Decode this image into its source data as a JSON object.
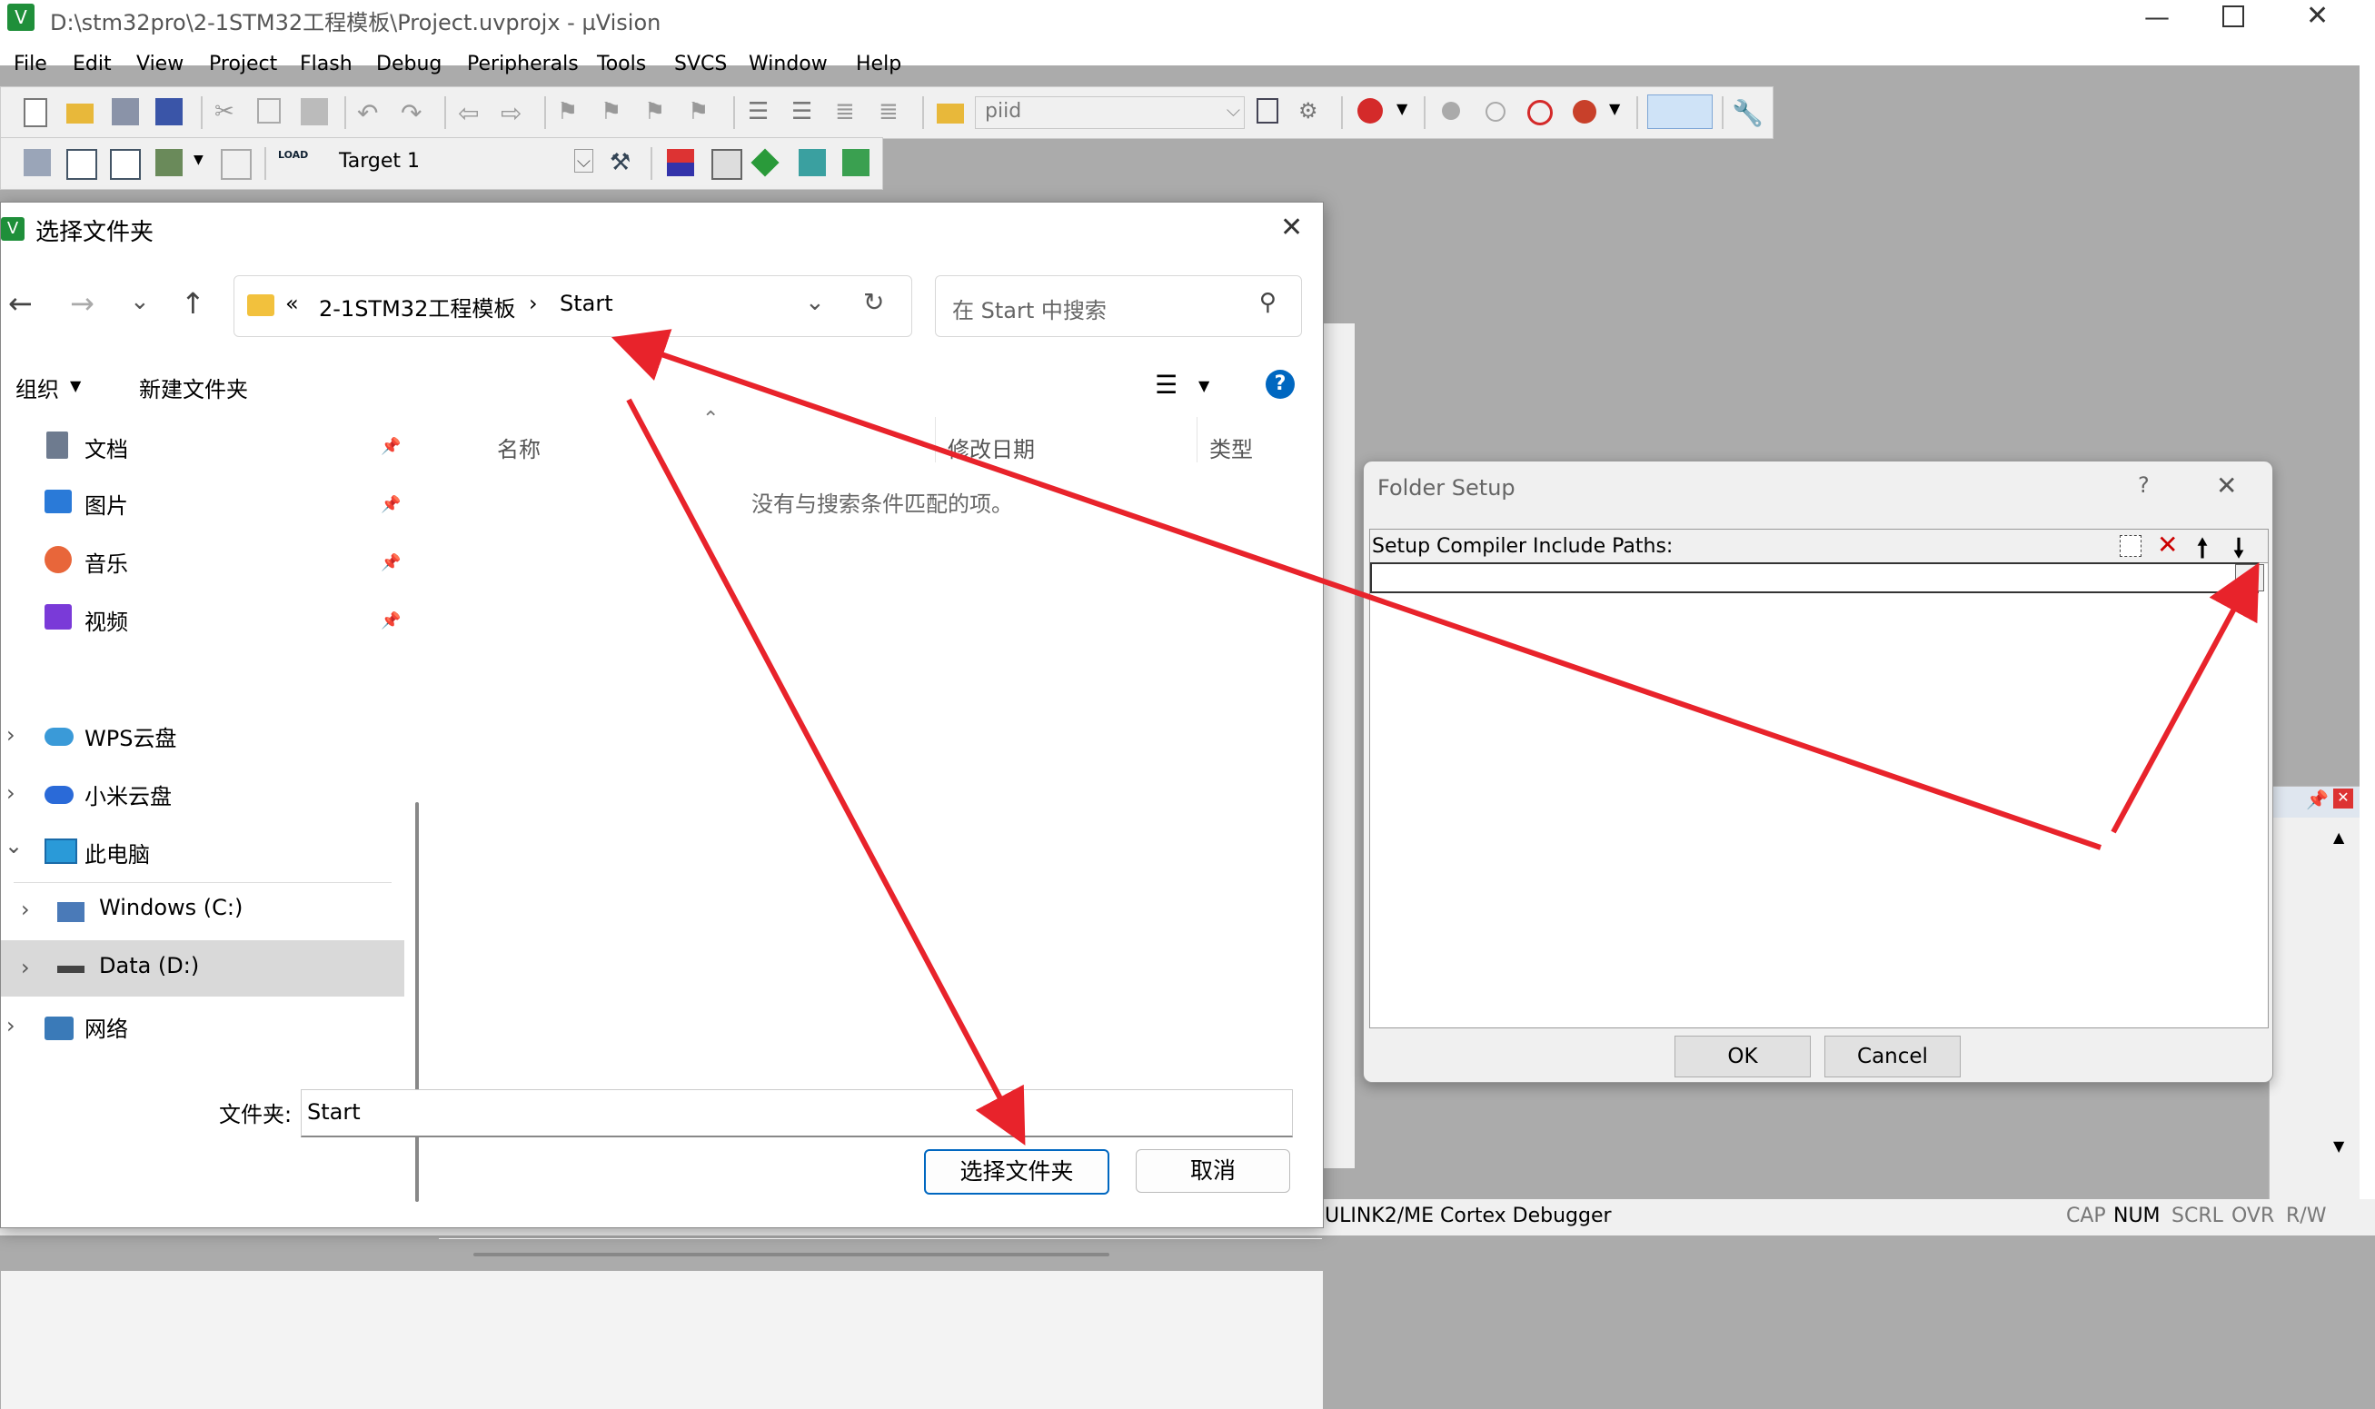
{
  "main": {
    "title": "D:\\stm32pro\\2-1STM32工程模板\\Project.uvprojx - µVision",
    "menu": [
      "File",
      "Edit",
      "View",
      "Project",
      "Flash",
      "Debug",
      "Peripherals",
      "Tools",
      "SVCS",
      "Window",
      "Help"
    ],
    "toolbar": {
      "find_value": "piid",
      "target_value": "Target 1",
      "load_icon_text": "LOAD"
    },
    "status": {
      "debugger": "ULINK2/ME Cortex Debugger",
      "cap": "CAP",
      "num": "NUM",
      "scrl": "SCRL",
      "ovr": "OVR",
      "rw": "R/W"
    }
  },
  "file_dialog": {
    "title": "选择文件夹",
    "breadcrumb": {
      "prefix": "«",
      "parent": "2-1STM32工程模板",
      "current": "Start"
    },
    "search_placeholder": "在 Start 中搜索",
    "commands": {
      "organize": "组织",
      "new_folder": "新建文件夹"
    },
    "nav": {
      "quick": [
        {
          "label": "文档"
        },
        {
          "label": "图片"
        },
        {
          "label": "音乐"
        },
        {
          "label": "视频"
        }
      ],
      "locations": [
        {
          "label": "WPS云盘"
        },
        {
          "label": "小米云盘"
        },
        {
          "label": "此电脑"
        },
        {
          "label": "Windows (C:)"
        },
        {
          "label": "Data (D:)"
        },
        {
          "label": "网络"
        }
      ]
    },
    "columns": {
      "name": "名称",
      "modified": "修改日期",
      "type": "类型"
    },
    "empty_message": "没有与搜索条件匹配的项。",
    "folder_label": "文件夹:",
    "folder_value": "Start",
    "select_button": "选择文件夹",
    "cancel_button": "取消"
  },
  "folder_setup": {
    "title": "Folder Setup",
    "help": "?",
    "list_title": "Setup Compiler Include Paths:",
    "browse_label": "...",
    "ok": "OK",
    "cancel": "Cancel"
  },
  "colors": {
    "arrow": "#e8232b",
    "selected_row": "#cce8ff",
    "accent": "#0067c0"
  }
}
